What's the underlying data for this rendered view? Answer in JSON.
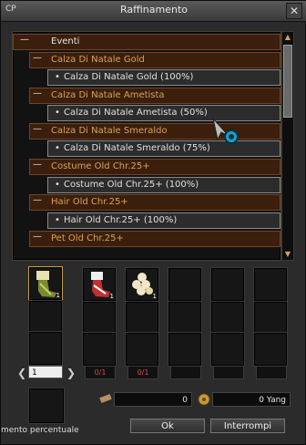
{
  "window": {
    "title": "Raffinamento",
    "cp": "CP",
    "close": "✕"
  },
  "list": {
    "top": {
      "dash": "—",
      "label": "Eventi"
    },
    "rows": [
      {
        "kind": "cat",
        "dash": "—",
        "label": "Calza Di Natale Gold"
      },
      {
        "kind": "item",
        "label": "Calza Di Natale Gold (100%)"
      },
      {
        "kind": "cat",
        "dash": "—",
        "label": "Calza Di Natale Ametista"
      },
      {
        "kind": "item",
        "label": "Calza Di Natale Ametista (50%)"
      },
      {
        "kind": "cat",
        "dash": "—",
        "label": "Calza Di Natale Smeraldo"
      },
      {
        "kind": "item",
        "label": "Calza Di Natale Smeraldo (75%)"
      },
      {
        "kind": "cat",
        "dash": "—",
        "label": "Costume Old Chr.25+"
      },
      {
        "kind": "item",
        "label": "Costume Old Chr.25+ (100%)"
      },
      {
        "kind": "cat",
        "dash": "—",
        "label": "Hair Old Chr.25+"
      },
      {
        "kind": "item",
        "label": "Hair Old Chr.25+ (100%)"
      },
      {
        "kind": "cat",
        "dash": "—",
        "label": "Pet Old Chr.25+"
      }
    ]
  },
  "materials": {
    "main_qty": "1",
    "slot1_qty": "1",
    "slot2_qty": "1",
    "counters": [
      "0/1",
      "0/1",
      "",
      "",
      "",
      ""
    ]
  },
  "pager": {
    "prev": "❮",
    "page": "1",
    "next": "❯"
  },
  "totals": {
    "count": "0",
    "yang": "0 Yang"
  },
  "buttons": {
    "ok": "Ok",
    "cancel": "Interrompi"
  },
  "status": "mento percentuale"
}
